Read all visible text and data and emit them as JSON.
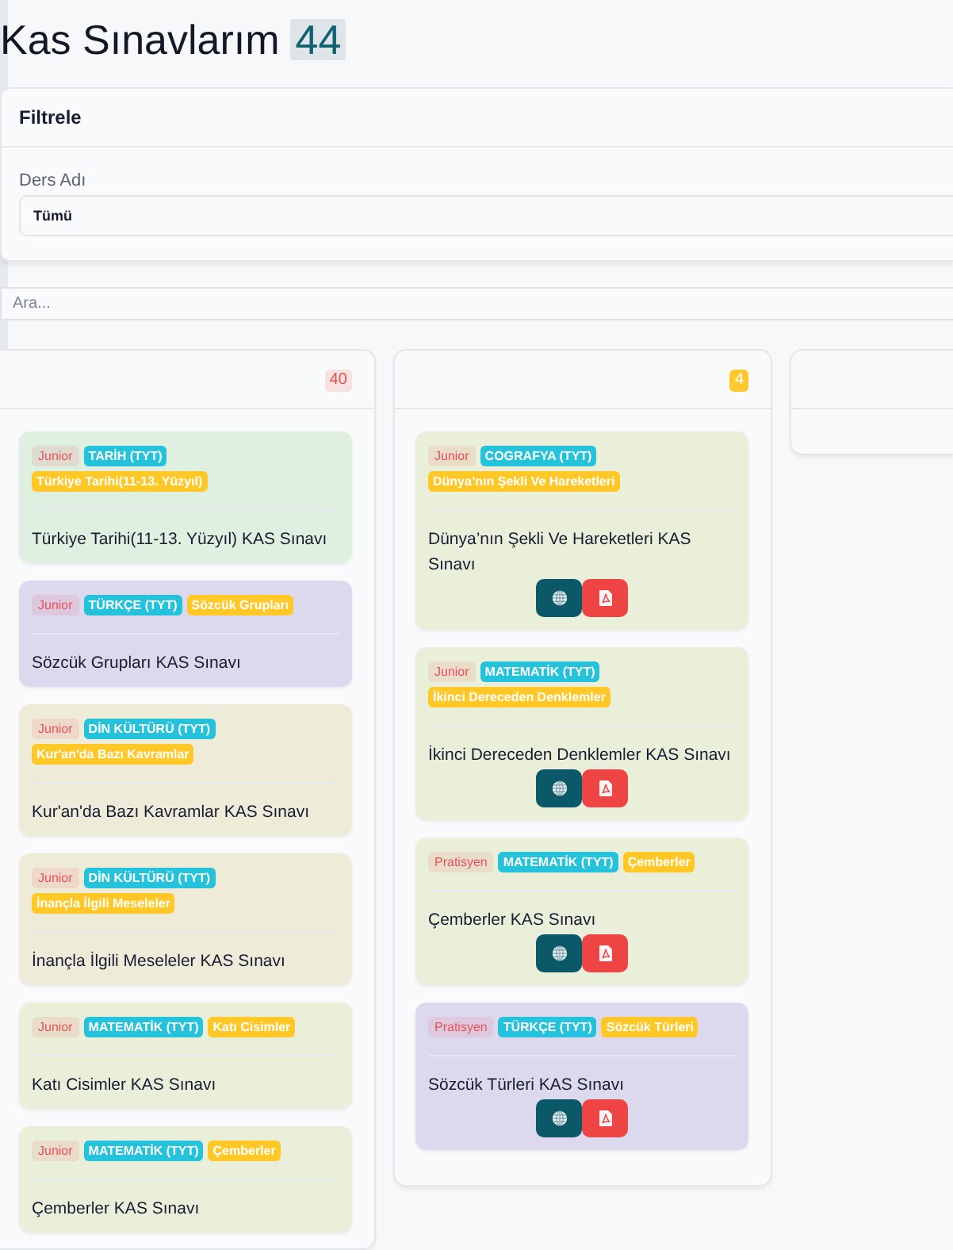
{
  "header": {
    "title": "Kas Sınavlarım",
    "count": "44"
  },
  "filter": {
    "title": "Filtrele",
    "fields": [
      {
        "label": "Ders Adı",
        "value": "Tümü"
      }
    ]
  },
  "search": {
    "placeholder": "Ara..."
  },
  "columns": [
    {
      "badge": {
        "text": "40",
        "color": "#e5534b",
        "kind": "light"
      },
      "cards": [
        {
          "color": "#dff0e0",
          "tags": [
            {
              "kind": "grade",
              "text": "Junior"
            },
            {
              "kind": "subject",
              "text": "TARİH (TYT)"
            },
            {
              "kind": "topic",
              "text": "Türkiye Tarihi(11-13. Yüzyıl)"
            }
          ],
          "title": "Türkiye Tarihi(11-13. Yüzyıl) KAS Sınavı"
        },
        {
          "color": "#dcd9ef",
          "tags": [
            {
              "kind": "grade",
              "text": "Junior"
            },
            {
              "kind": "subject",
              "text": "TÜRKÇE (TYT)"
            },
            {
              "kind": "topic",
              "text": "Sözcük Grupları"
            }
          ],
          "title": "Sözcük Grupları KAS Sınavı"
        },
        {
          "color": "#efebd9",
          "tags": [
            {
              "kind": "grade",
              "text": "Junior"
            },
            {
              "kind": "subject",
              "text": "DİN KÜLTÜRÜ (TYT)"
            },
            {
              "kind": "topic",
              "text": "Kur'an'da Bazı Kavramlar"
            }
          ],
          "title": "Kur'an'da Bazı Kavramlar KAS Sınavı"
        },
        {
          "color": "#efebd9",
          "tags": [
            {
              "kind": "grade",
              "text": "Junior"
            },
            {
              "kind": "subject",
              "text": "DİN KÜLTÜRÜ (TYT)"
            },
            {
              "kind": "topic",
              "text": "İnançla İlgili Meseleler"
            }
          ],
          "title": "İnançla İlgili Meseleler KAS Sınavı"
        },
        {
          "color": "#eaefd9",
          "tags": [
            {
              "kind": "grade",
              "text": "Junior"
            },
            {
              "kind": "subject",
              "text": "MATEMATİK (TYT)"
            },
            {
              "kind": "topic",
              "text": "Katı Cisimler"
            }
          ],
          "title": "Katı Cisimler KAS Sınavı"
        },
        {
          "color": "#eaefd9",
          "tags": [
            {
              "kind": "grade",
              "text": "Junior"
            },
            {
              "kind": "subject",
              "text": "MATEMATİK (TYT)"
            },
            {
              "kind": "topic",
              "text": "Çemberler"
            }
          ],
          "title": "Çemberler KAS Sınavı"
        }
      ]
    },
    {
      "badge": {
        "text": "4",
        "color": "#ffc82c",
        "kind": "solid"
      },
      "cards": [
        {
          "color": "#eaefd9",
          "tags": [
            {
              "kind": "grade",
              "text": "Junior"
            },
            {
              "kind": "subject",
              "text": "COGRAFYA (TYT)"
            },
            {
              "kind": "topic",
              "text": "Dünya’nın Şekli Ve Hareketleri"
            }
          ],
          "title": "Dünya’nın Şekli Ve Hareketleri KAS Sınavı",
          "actions": [
            {
              "kind": "web"
            },
            {
              "kind": "pdf"
            }
          ]
        },
        {
          "color": "#eaefd9",
          "tags": [
            {
              "kind": "grade",
              "text": "Junior"
            },
            {
              "kind": "subject",
              "text": "MATEMATİK (TYT)"
            },
            {
              "kind": "topic",
              "text": "İkinci Dereceden Denklemler"
            }
          ],
          "title": "İkinci Dereceden Denklemler KAS Sınavı",
          "actions": [
            {
              "kind": "web"
            },
            {
              "kind": "pdf"
            }
          ]
        },
        {
          "color": "#eaefd9",
          "tags": [
            {
              "kind": "grade",
              "text": "Pratisyen"
            },
            {
              "kind": "subject",
              "text": "MATEMATİK (TYT)"
            },
            {
              "kind": "topic",
              "text": "Çemberler"
            }
          ],
          "title": "Çemberler KAS Sınavı",
          "actions": [
            {
              "kind": "web"
            },
            {
              "kind": "pdf"
            }
          ]
        },
        {
          "color": "#dcd9ef",
          "tags": [
            {
              "kind": "grade",
              "text": "Pratisyen"
            },
            {
              "kind": "subject",
              "text": "TÜRKÇE (TYT)"
            },
            {
              "kind": "topic",
              "text": "Sözcük Türleri"
            }
          ],
          "title": "Sözcük Türleri KAS Sınavı",
          "actions": [
            {
              "kind": "web"
            },
            {
              "kind": "pdf"
            }
          ]
        }
      ]
    },
    {}
  ]
}
